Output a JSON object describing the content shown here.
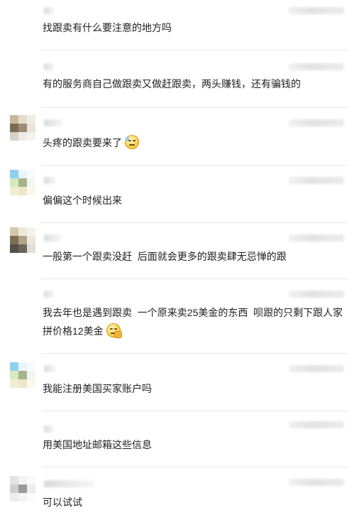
{
  "comments": [
    {
      "text": "找跟卖有什么要注意的地方吗",
      "avatar_colors": null
    },
    {
      "text": "有的服务商自己做跟卖又做赶跟卖，两头赚钱，还有骗钱的",
      "avatar_colors": null
    },
    {
      "text": "头疼的跟卖要来了",
      "emoji": "sweat-face-icon",
      "avatar_colors": [
        "#c9b79a",
        "#e6dccb",
        "#f1ece4",
        "#7d6a55",
        "#a08b72",
        "#e9e4dc",
        "#d8d2c8",
        "#efeae4",
        "#f6f3ef"
      ]
    },
    {
      "text": "偏偏这个时候出来",
      "avatar_colors": [
        "#8fd0ef",
        "#e9f5fb",
        "#f7fbfd",
        "#d6e9c0",
        "#a4b58a",
        "#f3f6ef",
        "#f3ecd5",
        "#efe6c8",
        "#fbf8ef"
      ]
    },
    {
      "text": "一般第一个跟卖没赶  后面就会更多的跟卖肆无忌惮的跟",
      "avatar_colors": [
        "#d5c8a8",
        "#efe8d8",
        "#f6f2ea",
        "#7e6e57",
        "#b3a385",
        "#ece7dd",
        "#555049",
        "#6b655c",
        "#e2ded7"
      ]
    },
    {
      "text": "我去年也是遇到跟卖  一个原来卖25美金的东西  呗跟的只剩下跟人家拼价格12美金",
      "emoji": "facepalm-icon",
      "avatar_colors": null
    },
    {
      "text": "我能注册美国买家账户吗",
      "avatar_colors": [
        "#8fd0ef",
        "#e9f5fb",
        "#f7fbfd",
        "#d6e9c0",
        "#a4b58a",
        "#f3f6ef",
        "#f3ecd5",
        "#efe6c8",
        "#fbf8ef"
      ]
    },
    {
      "text": "用美国地址邮箱这些信息",
      "avatar_colors": null
    },
    {
      "text": "可以试试",
      "avatar_colors": [
        "#e4e4e4",
        "#f2f2f2",
        "#fafafa",
        "#cfcfcf",
        "#9a9a9a",
        "#ececec",
        "#ededed",
        "#f4f4f4",
        "#fbfbfb"
      ]
    }
  ]
}
